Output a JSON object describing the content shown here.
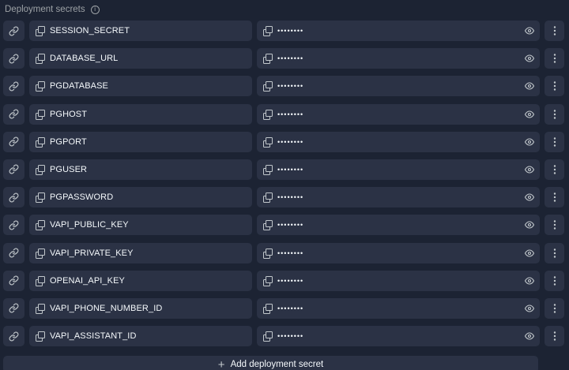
{
  "header": {
    "title": "Deployment secrets",
    "info_icon": "info-icon"
  },
  "secrets": [
    {
      "name": "SESSION_SECRET",
      "value": "••••••••"
    },
    {
      "name": "DATABASE_URL",
      "value": "••••••••"
    },
    {
      "name": "PGDATABASE",
      "value": "••••••••"
    },
    {
      "name": "PGHOST",
      "value": "••••••••"
    },
    {
      "name": "PGPORT",
      "value": "••••••••"
    },
    {
      "name": "PGUSER",
      "value": "••••••••"
    },
    {
      "name": "PGPASSWORD",
      "value": "••••••••"
    },
    {
      "name": "VAPI_PUBLIC_KEY",
      "value": "••••••••"
    },
    {
      "name": "VAPI_PRIVATE_KEY",
      "value": "••••••••"
    },
    {
      "name": "OPENAI_API_KEY",
      "value": "••••••••"
    },
    {
      "name": "VAPI_PHONE_NUMBER_ID",
      "value": "••••••••"
    },
    {
      "name": "VAPI_ASSISTANT_ID",
      "value": "••••••••"
    }
  ],
  "add_button": {
    "label": "Add deployment secret",
    "icon": "plus-icon"
  },
  "colors": {
    "background": "#1c2333",
    "surface": "#2b3245",
    "text": "#f5f9fc",
    "muted": "#9da2a6"
  }
}
